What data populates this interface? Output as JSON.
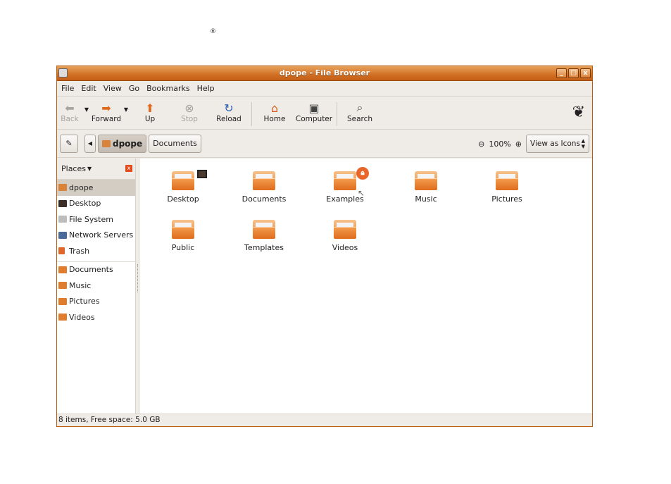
{
  "registered_mark": "®",
  "window": {
    "title": "dpope - File Browser",
    "controls": {
      "minimize": "_",
      "maximize": "□",
      "close": "x"
    }
  },
  "menubar": [
    "File",
    "Edit",
    "View",
    "Go",
    "Bookmarks",
    "Help"
  ],
  "toolbar": {
    "back": "Back",
    "forward": "Forward",
    "up": "Up",
    "stop": "Stop",
    "reload": "Reload",
    "home": "Home",
    "computer": "Computer",
    "search": "Search"
  },
  "location": {
    "current": "dpope",
    "next": "Documents",
    "zoom": "100%",
    "view_mode": "View as Icons"
  },
  "sidebar": {
    "header": "Places",
    "places": [
      "dpope",
      "Desktop",
      "File System",
      "Network Servers",
      "Trash"
    ],
    "bookmarks": [
      "Documents",
      "Music",
      "Pictures",
      "Videos"
    ]
  },
  "files": [
    "Desktop",
    "Documents",
    "Examples",
    "Music",
    "Pictures",
    "Public",
    "Templates",
    "Videos"
  ],
  "status": "8 items, Free space: 5.0 GB",
  "colors": {
    "accent": "#d17025",
    "folder": "#e07c2e"
  }
}
